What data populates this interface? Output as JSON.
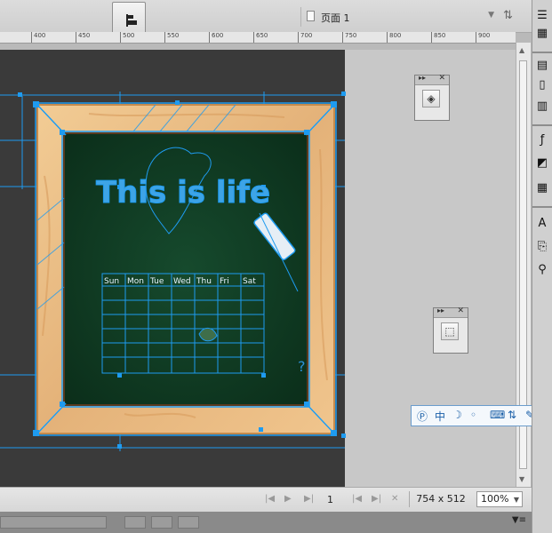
{
  "header": {
    "page_label": "页面 1"
  },
  "ruler": {
    "ticks": [
      "400",
      "450",
      "500",
      "550",
      "600",
      "650",
      "700",
      "750",
      "800",
      "850",
      "900"
    ]
  },
  "artwork": {
    "headline": "This is life",
    "calendar_days": [
      "Sun",
      "Mon",
      "Tue",
      "Wed",
      "Thu",
      "Fri",
      "Sat"
    ]
  },
  "statusbar": {
    "page_number": "1",
    "canvas_size": "754 x 512",
    "zoom": "100%"
  },
  "colors": {
    "selection": "#1e9bf0",
    "chalkboard": "#0f3a22",
    "frame_wood": "#e8b980",
    "canvas_dark": "#3a3a3a"
  },
  "icons": {
    "align_panel": "align-icon",
    "layers_panel": "layers-icon",
    "path_panel": "path-icon"
  }
}
